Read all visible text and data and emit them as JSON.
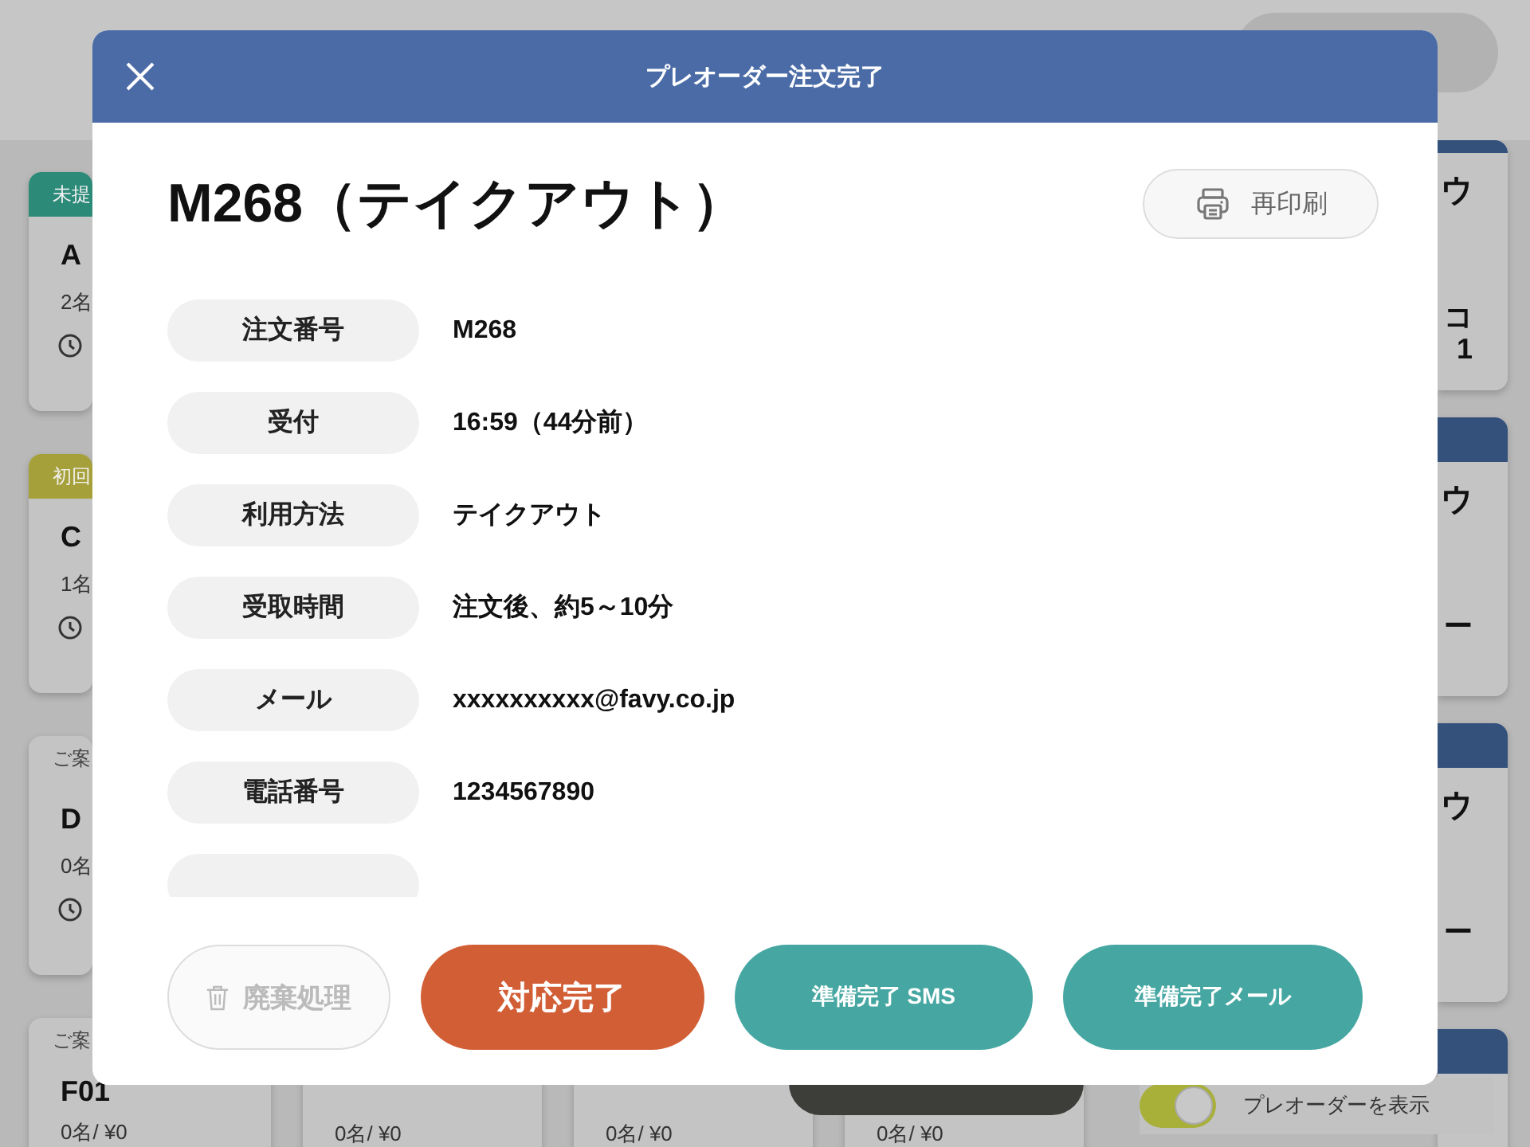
{
  "background": {
    "search": {
      "kind": "pill"
    },
    "left_cards": [
      {
        "tag": "未提",
        "color": "#2c8a79",
        "name": "A",
        "summary": "2名",
        "clock": true
      },
      {
        "tag": "初回",
        "color": "#a6a03a",
        "name": "C",
        "summary": "1名",
        "clock": true
      },
      {
        "tag": "ご案",
        "name": "D",
        "summary": "0名",
        "clock": true
      },
      {
        "tag": "ご案",
        "name": "F01",
        "summary": "0名/ ¥0",
        "clock": false
      }
    ],
    "bottom_cards": [
      {
        "summary": "0名/ ¥0"
      },
      {
        "summary": "0名/ ¥0"
      },
      {
        "summary": "0名/ ¥0"
      }
    ],
    "right_cards": [
      {
        "color": "#34517c",
        "title": "ウ",
        "details": [
          "コ",
          "1"
        ]
      },
      {
        "color": "#34517c",
        "title": "ウ",
        "details": [
          "ー"
        ]
      },
      {
        "color": "#34517c",
        "title": "ウ",
        "details": [
          "ー"
        ]
      },
      {
        "color": "#34517c"
      }
    ],
    "preorder_toggle": {
      "label": "プレオーダーを表示",
      "on": true
    }
  },
  "modal": {
    "title": "プレオーダー注文完了",
    "heading": "M268（テイクアウト）",
    "reprint_button": "再印刷",
    "details": [
      {
        "label": "注文番号",
        "value": "M268"
      },
      {
        "label": "受付",
        "value": "16:59（44分前）"
      },
      {
        "label": "利用方法",
        "value": "テイクアウト"
      },
      {
        "label": "受取時間",
        "value": "注文後、約5～10分"
      },
      {
        "label": "メール",
        "value": "xxxxxxxxxx@favy.co.jp"
      },
      {
        "label": "電話番号",
        "value": "1234567890"
      }
    ],
    "buttons": [
      {
        "kind": "discard",
        "label": "廃棄処理",
        "disabled": true
      },
      {
        "kind": "complete",
        "label": "対応完了",
        "disabled": false
      },
      {
        "kind": "notify",
        "label": "準備完了 SMS",
        "disabled": false
      },
      {
        "kind": "notify",
        "label": "準備完了メール",
        "disabled": false
      }
    ]
  }
}
